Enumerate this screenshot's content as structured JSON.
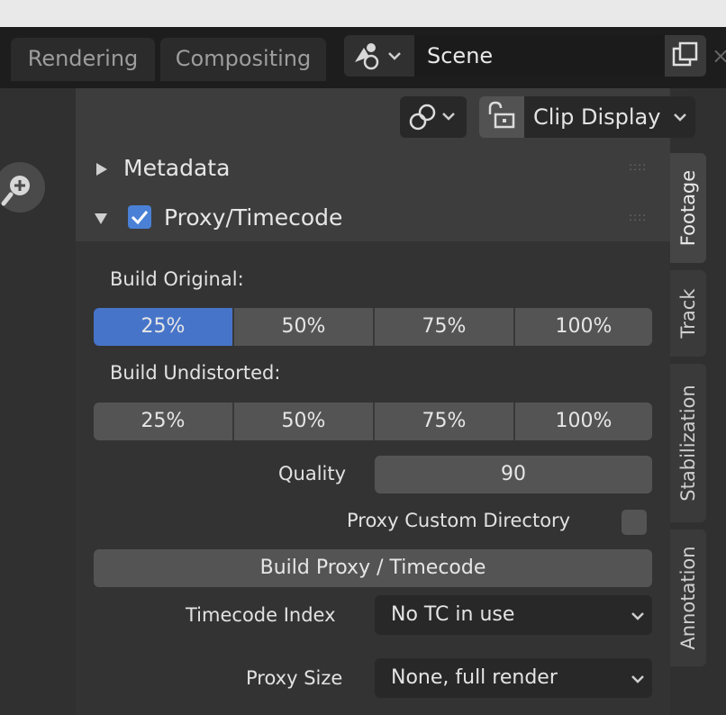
{
  "workspace_tabs": [
    "Rendering",
    "Compositing"
  ],
  "scene": {
    "name": "Scene"
  },
  "header": {
    "display_mode": "Clip Display"
  },
  "panels": {
    "metadata": {
      "title": "Metadata"
    },
    "proxy": {
      "title": "Proxy/Timecode",
      "enabled": true,
      "build_original_label": "Build Original:",
      "build_original_options": [
        "25%",
        "50%",
        "75%",
        "100%"
      ],
      "build_original_selected": 0,
      "build_undistorted_label": "Build Undistorted:",
      "build_undistorted_options": [
        "25%",
        "50%",
        "75%",
        "100%"
      ],
      "quality_label": "Quality",
      "quality_value": "90",
      "custom_dir_label": "Proxy Custom Directory",
      "custom_dir_checked": false,
      "build_button": "Build Proxy / Timecode",
      "timecode_label": "Timecode Index",
      "timecode_value": "No TC in use",
      "proxy_size_label": "Proxy Size",
      "proxy_size_value": "None, full render"
    }
  },
  "sidebar_tabs": [
    "Footage",
    "Track",
    "Stabilization",
    "Annotation"
  ],
  "active_sidebar_tab": "Footage",
  "colors": {
    "accent": "#4674c8",
    "checkbox": "#4a81d6"
  }
}
